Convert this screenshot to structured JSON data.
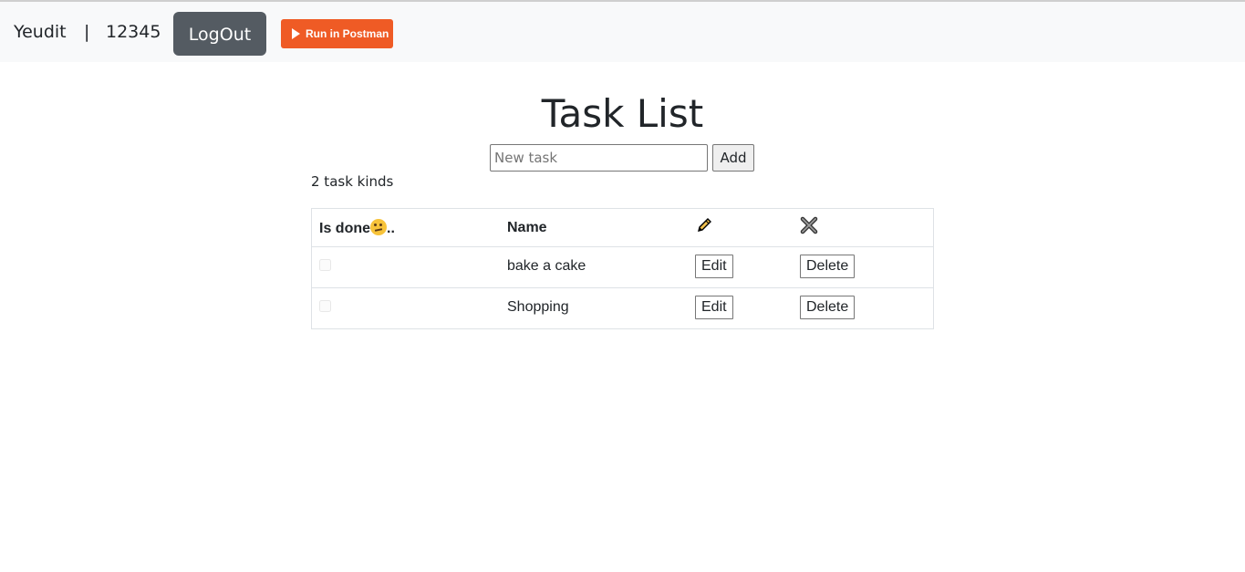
{
  "header": {
    "user_name": "Yeudit",
    "separator": "|",
    "user_id": "12345",
    "logout_label": "LogOut",
    "postman_label": "Run in Postman"
  },
  "main": {
    "title": "Task List",
    "new_task_placeholder": "New task",
    "new_task_value": "",
    "add_label": "Add",
    "task_count": "2 task kinds"
  },
  "table": {
    "headers": {
      "is_done": "Is done",
      "is_done_suffix": "..",
      "is_done_icon": "thinking-face-emoji",
      "name": "Name",
      "edit_icon": "pencil-icon",
      "delete_icon": "cross-mark-icon"
    },
    "rows": [
      {
        "done": false,
        "name": "bake a cake",
        "edit_label": "Edit",
        "delete_label": "Delete"
      },
      {
        "done": false,
        "name": "Shopping",
        "edit_label": "Edit",
        "delete_label": "Delete"
      }
    ]
  },
  "colors": {
    "topbar_bg": "#f8f9fa",
    "logout_bg": "#545b62",
    "postman_bg": "#ef5b25",
    "text": "#212529",
    "table_border": "#dee2e6"
  }
}
